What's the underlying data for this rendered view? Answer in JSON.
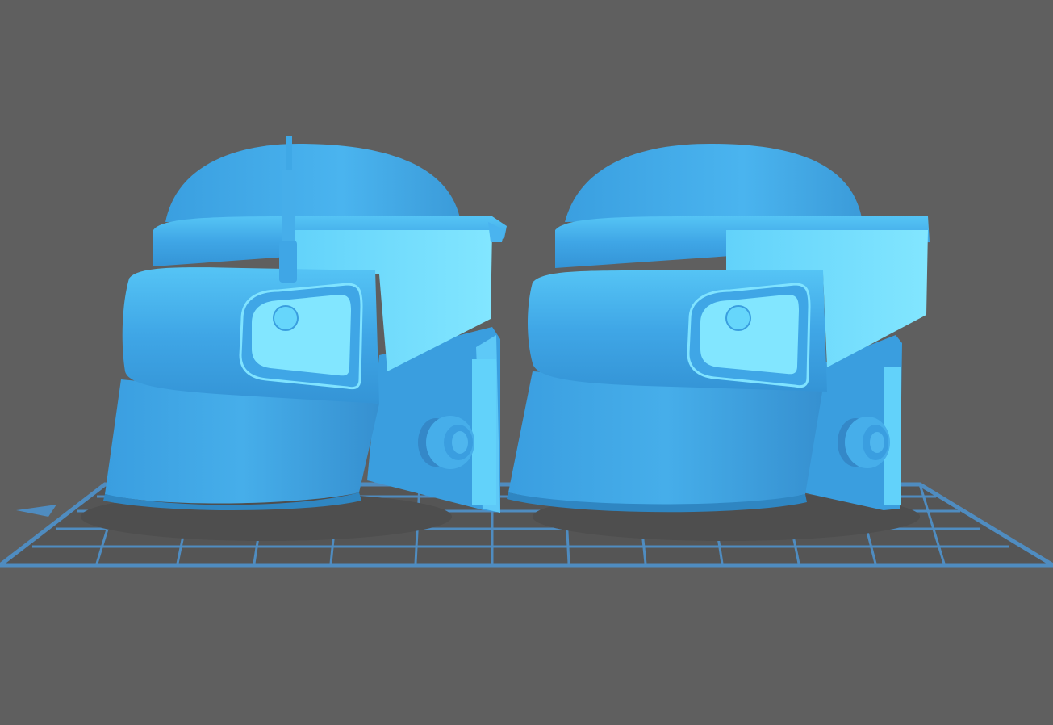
{
  "viewport": {
    "background": "#5f5f5f",
    "bed_grid_color": "#4f8cc0",
    "bed_plate_color": "#555555",
    "model_color_light": "#7fe3ff",
    "model_color_mid": "#3fa8e6",
    "model_color_dark": "#2f86c2"
  },
  "objects": [
    {
      "name": "helmet-with-antenna"
    },
    {
      "name": "helmet-without-antenna"
    }
  ]
}
